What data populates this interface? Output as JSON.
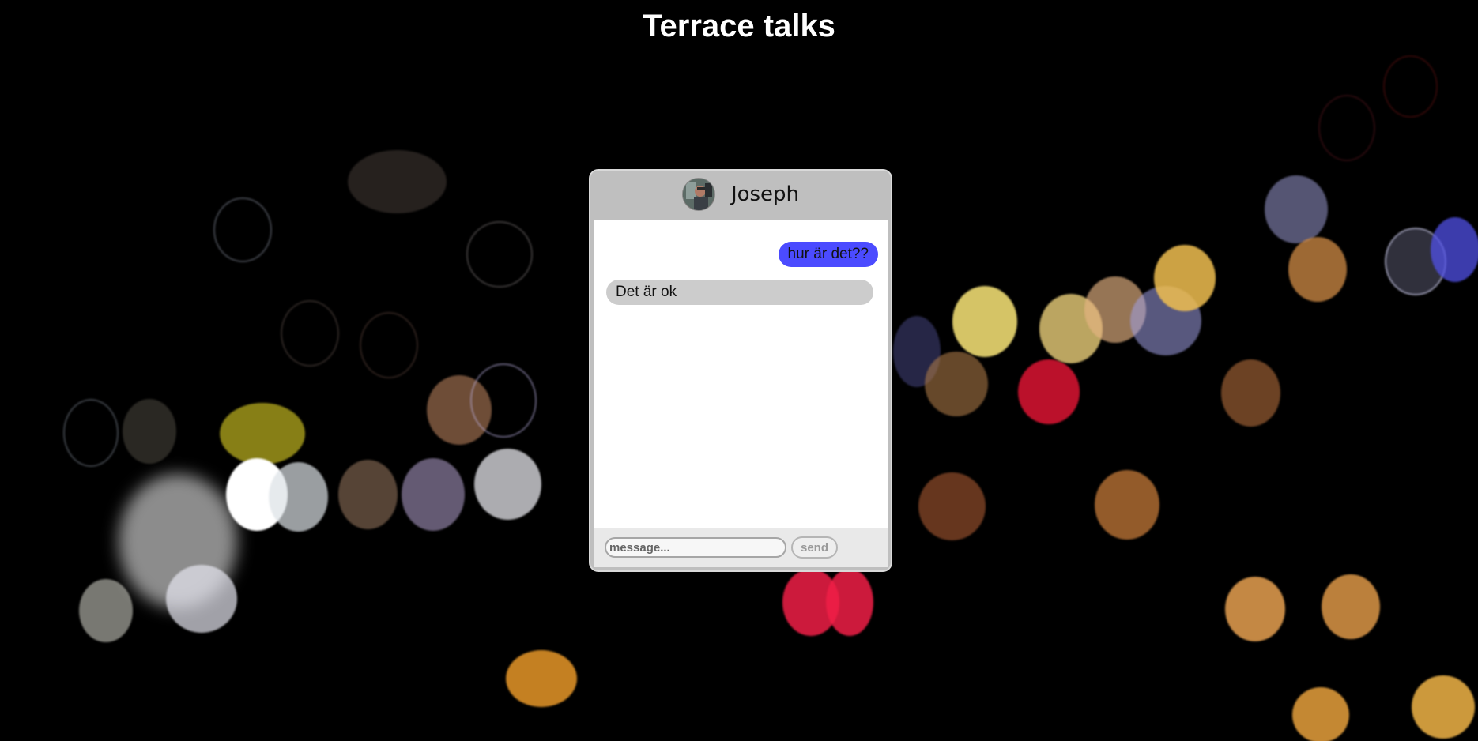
{
  "page": {
    "title": "Terrace talks"
  },
  "chat": {
    "contact_name": "Joseph",
    "messages": [
      {
        "direction": "outgoing",
        "text": "hur är det??"
      },
      {
        "direction": "incoming",
        "text": "Det är ok"
      }
    ],
    "composer": {
      "placeholder": "message...",
      "value": "",
      "send_label": "send"
    }
  },
  "colors": {
    "background": "#000000",
    "outgoing_bubble": "#4b4bff",
    "incoming_bubble": "#cccccc",
    "window_frame": "#bfbfbf"
  },
  "icons": {
    "avatar": "contact-avatar-photo"
  }
}
